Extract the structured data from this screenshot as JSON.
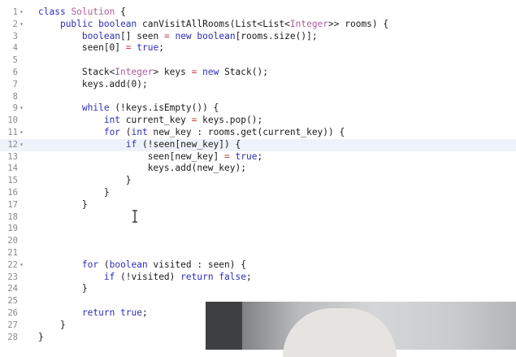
{
  "editor": {
    "lines": [
      {
        "n": "1",
        "fold": true,
        "tokens": [
          [
            "kw",
            "class"
          ],
          [
            "pl",
            " "
          ],
          [
            "ty",
            "Solution"
          ],
          [
            "pl",
            " {"
          ]
        ]
      },
      {
        "n": "2",
        "fold": true,
        "tokens": [
          [
            "pl",
            "    "
          ],
          [
            "kw",
            "public"
          ],
          [
            "pl",
            " "
          ],
          [
            "kw",
            "boolean"
          ],
          [
            "pl",
            " canVisitAllRooms(List<List<"
          ],
          [
            "ty",
            "Integer"
          ],
          [
            "pl",
            ">> rooms) {"
          ]
        ]
      },
      {
        "n": "3",
        "fold": false,
        "tokens": [
          [
            "pl",
            "        "
          ],
          [
            "kw",
            "boolean"
          ],
          [
            "pl",
            "[] seen "
          ],
          [
            "op",
            "="
          ],
          [
            "pl",
            " "
          ],
          [
            "kw",
            "new"
          ],
          [
            "pl",
            " "
          ],
          [
            "kw",
            "boolean"
          ],
          [
            "pl",
            "[rooms.size()];"
          ]
        ]
      },
      {
        "n": "4",
        "fold": false,
        "tokens": [
          [
            "pl",
            "        seen[0] "
          ],
          [
            "op",
            "="
          ],
          [
            "pl",
            " "
          ],
          [
            "bl",
            "true"
          ],
          [
            "pl",
            ";"
          ]
        ]
      },
      {
        "n": "5",
        "fold": false,
        "tokens": []
      },
      {
        "n": "6",
        "fold": false,
        "tokens": [
          [
            "pl",
            "        Stack<"
          ],
          [
            "ty",
            "Integer"
          ],
          [
            "pl",
            "> keys "
          ],
          [
            "op",
            "="
          ],
          [
            "pl",
            " "
          ],
          [
            "kw",
            "new"
          ],
          [
            "pl",
            " Stack();"
          ]
        ]
      },
      {
        "n": "7",
        "fold": false,
        "tokens": [
          [
            "pl",
            "        keys.add(0);"
          ]
        ]
      },
      {
        "n": "8",
        "fold": false,
        "tokens": []
      },
      {
        "n": "9",
        "fold": true,
        "tokens": [
          [
            "pl",
            "        "
          ],
          [
            "kw",
            "while"
          ],
          [
            "pl",
            " (!keys.isEmpty()) {"
          ]
        ]
      },
      {
        "n": "10",
        "fold": false,
        "tokens": [
          [
            "pl",
            "            "
          ],
          [
            "kw",
            "int"
          ],
          [
            "pl",
            " current_key "
          ],
          [
            "op",
            "="
          ],
          [
            "pl",
            " keys.pop();"
          ]
        ]
      },
      {
        "n": "11",
        "fold": true,
        "tokens": [
          [
            "pl",
            "            "
          ],
          [
            "kw",
            "for"
          ],
          [
            "pl",
            " ("
          ],
          [
            "kw",
            "int"
          ],
          [
            "pl",
            " new_key : rooms.get(current_key)) {"
          ]
        ]
      },
      {
        "n": "12",
        "fold": true,
        "active": true,
        "tokens": [
          [
            "pl",
            "                "
          ],
          [
            "kw",
            "if"
          ],
          [
            "pl",
            " (!seen[new_key]) {"
          ]
        ]
      },
      {
        "n": "13",
        "fold": false,
        "tokens": [
          [
            "pl",
            "                    seen[new_key] "
          ],
          [
            "op",
            "="
          ],
          [
            "pl",
            " "
          ],
          [
            "bl",
            "true"
          ],
          [
            "pl",
            ";"
          ]
        ]
      },
      {
        "n": "14",
        "fold": false,
        "tokens": [
          [
            "pl",
            "                    keys.add(new_key);"
          ]
        ]
      },
      {
        "n": "15",
        "fold": false,
        "tokens": [
          [
            "pl",
            "                }"
          ]
        ]
      },
      {
        "n": "16",
        "fold": false,
        "tokens": [
          [
            "pl",
            "            }"
          ]
        ]
      },
      {
        "n": "17",
        "fold": false,
        "tokens": [
          [
            "pl",
            "        }"
          ]
        ]
      },
      {
        "n": "18",
        "fold": false,
        "tokens": []
      },
      {
        "n": "19",
        "fold": false,
        "tokens": []
      },
      {
        "n": "20",
        "fold": false,
        "tokens": []
      },
      {
        "n": "21",
        "fold": false,
        "tokens": []
      },
      {
        "n": "22",
        "fold": true,
        "tokens": [
          [
            "pl",
            "        "
          ],
          [
            "kw",
            "for"
          ],
          [
            "pl",
            " ("
          ],
          [
            "kw",
            "boolean"
          ],
          [
            "pl",
            " visited : seen) {"
          ]
        ]
      },
      {
        "n": "23",
        "fold": false,
        "tokens": [
          [
            "pl",
            "            "
          ],
          [
            "kw",
            "if"
          ],
          [
            "pl",
            " (!visited) "
          ],
          [
            "kw",
            "return"
          ],
          [
            "pl",
            " "
          ],
          [
            "bl",
            "false"
          ],
          [
            "pl",
            ";"
          ]
        ]
      },
      {
        "n": "24",
        "fold": false,
        "tokens": [
          [
            "pl",
            "        }"
          ]
        ]
      },
      {
        "n": "25",
        "fold": false,
        "tokens": []
      },
      {
        "n": "26",
        "fold": false,
        "tokens": [
          [
            "pl",
            "        "
          ],
          [
            "kw",
            "return"
          ],
          [
            "pl",
            " "
          ],
          [
            "bl",
            "true"
          ],
          [
            "pl",
            ";"
          ]
        ]
      },
      {
        "n": "27",
        "fold": false,
        "tokens": [
          [
            "pl",
            "    }"
          ]
        ]
      },
      {
        "n": "28",
        "fold": false,
        "tokens": [
          [
            "pl",
            "}"
          ]
        ]
      }
    ]
  },
  "colors": {
    "keyword": "#2d2db8",
    "type": "#b05a9d",
    "operator": "#c04040",
    "active_line": "#eef3fb",
    "gutter": "#8a8a8a"
  },
  "icons": {
    "fold": "fold-arrow-icon",
    "cursor": "text-cursor-icon"
  }
}
